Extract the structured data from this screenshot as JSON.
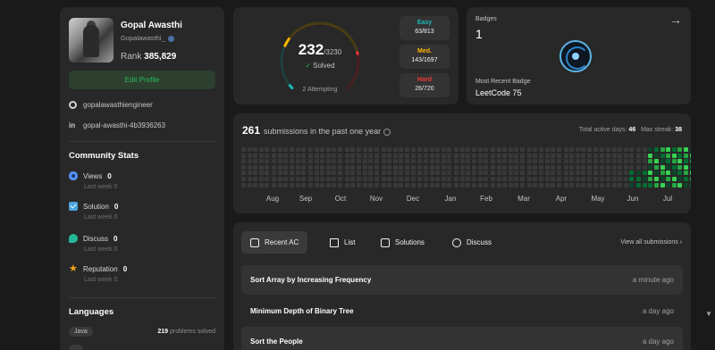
{
  "profile": {
    "name": "Gopal Awasthi",
    "username": "Gopalawasthi_",
    "rank_label": "Rank",
    "rank_value": "385,829",
    "edit_label": "Edit Profile",
    "github": "gopalawasthiengineer",
    "linkedin": "gopal-awasthi-4b3936263",
    "linkedin_icon": "in"
  },
  "community": {
    "title": "Community Stats",
    "items": [
      {
        "label": "Views",
        "value": "0",
        "sub_label": "Last week",
        "sub_value": "0",
        "icon": "eye-icon"
      },
      {
        "label": "Solution",
        "value": "0",
        "sub_label": "Last week",
        "sub_value": "0",
        "icon": "check-icon"
      },
      {
        "label": "Discuss",
        "value": "0",
        "sub_label": "Last week",
        "sub_value": "0",
        "icon": "discuss-icon"
      },
      {
        "label": "Reputation",
        "value": "0",
        "sub_label": "Last week",
        "sub_value": "0",
        "icon": "star-icon"
      }
    ]
  },
  "languages": {
    "title": "Languages",
    "items": [
      {
        "name": "Java",
        "count": "219",
        "suffix": "problems solved"
      }
    ]
  },
  "solved": {
    "solved": "232",
    "total": "/3230",
    "solved_label": "Solved",
    "check": "✓",
    "attempting": "2 Attempting",
    "easy": {
      "label": "Easy",
      "count": "63/813",
      "color": "#1cbaba"
    },
    "medium": {
      "label": "Med.",
      "count": "143/1697",
      "color": "#ffb700"
    },
    "hard": {
      "label": "Hard",
      "count": "26/720",
      "color": "#f63737"
    }
  },
  "badges": {
    "title": "Badges",
    "count": "1",
    "arrow": "→",
    "recent_label": "Most Recent Badge",
    "recent_name": "LeetCode 75"
  },
  "heatmap": {
    "count": "261",
    "label": "submissions in the past one year",
    "active_days_label": "Total active days:",
    "active_days": "46",
    "max_streak_label": "Max streak:",
    "max_streak": "38",
    "months": [
      "Aug",
      "Sep",
      "Oct",
      "Nov",
      "Dec",
      "Jan",
      "Feb",
      "Mar",
      "Apr",
      "May",
      "Jun",
      "Jul"
    ],
    "colors": {
      "empty": "#393939",
      "l1": "#0e4429",
      "l2": "#006d32",
      "l3": "#26a641",
      "l4": "#39d353"
    }
  },
  "recent": {
    "tabs": [
      {
        "label": "Recent AC",
        "icon": "recent-ac-icon"
      },
      {
        "label": "List",
        "icon": "list-icon"
      },
      {
        "label": "Solutions",
        "icon": "solutions-icon"
      },
      {
        "label": "Discuss",
        "icon": "discuss-search-icon"
      }
    ],
    "view_all": "View all submissions ›",
    "items": [
      {
        "title": "Sort Array by Increasing Frequency",
        "time": "a minute ago"
      },
      {
        "title": "Minimum Depth of Binary Tree",
        "time": "a day ago"
      },
      {
        "title": "Sort the People",
        "time": "a day ago"
      }
    ]
  },
  "scrollbar": {
    "down_arrow": "▼"
  }
}
